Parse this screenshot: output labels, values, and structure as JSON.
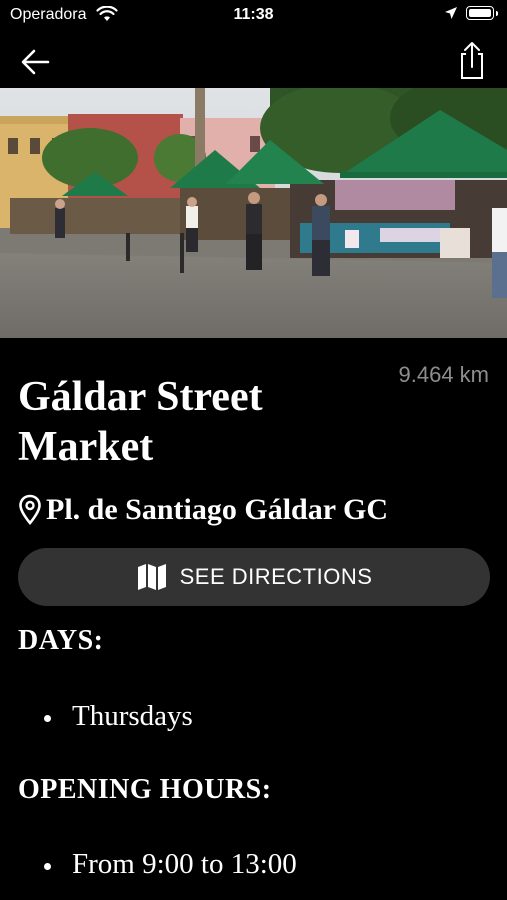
{
  "status_bar": {
    "carrier": "Operadora",
    "time": "11:38",
    "icons": [
      "wifi-icon",
      "location-arrow-icon",
      "battery-icon"
    ]
  },
  "navbar": {
    "back_icon": "arrow-left-icon",
    "share_icon": "share-icon"
  },
  "market": {
    "name": "Gáldar Street Market",
    "distance": "9.464 km",
    "address": "Pl. de Santiago Gáldar GC",
    "address_icon": "map-pin-icon"
  },
  "directions": {
    "label": "SEE DIRECTIONS",
    "icon": "map-icon"
  },
  "days": {
    "heading": "DAYS:",
    "items": [
      "Thursdays"
    ]
  },
  "hours": {
    "heading": "OPENING HOURS:",
    "items": [
      "From 9:00 to 13:00"
    ]
  },
  "colors": {
    "background": "#000000",
    "text": "#ffffff",
    "muted": "#8d8d8d",
    "button": "#333333",
    "awning_green": "#1f7a4a"
  }
}
